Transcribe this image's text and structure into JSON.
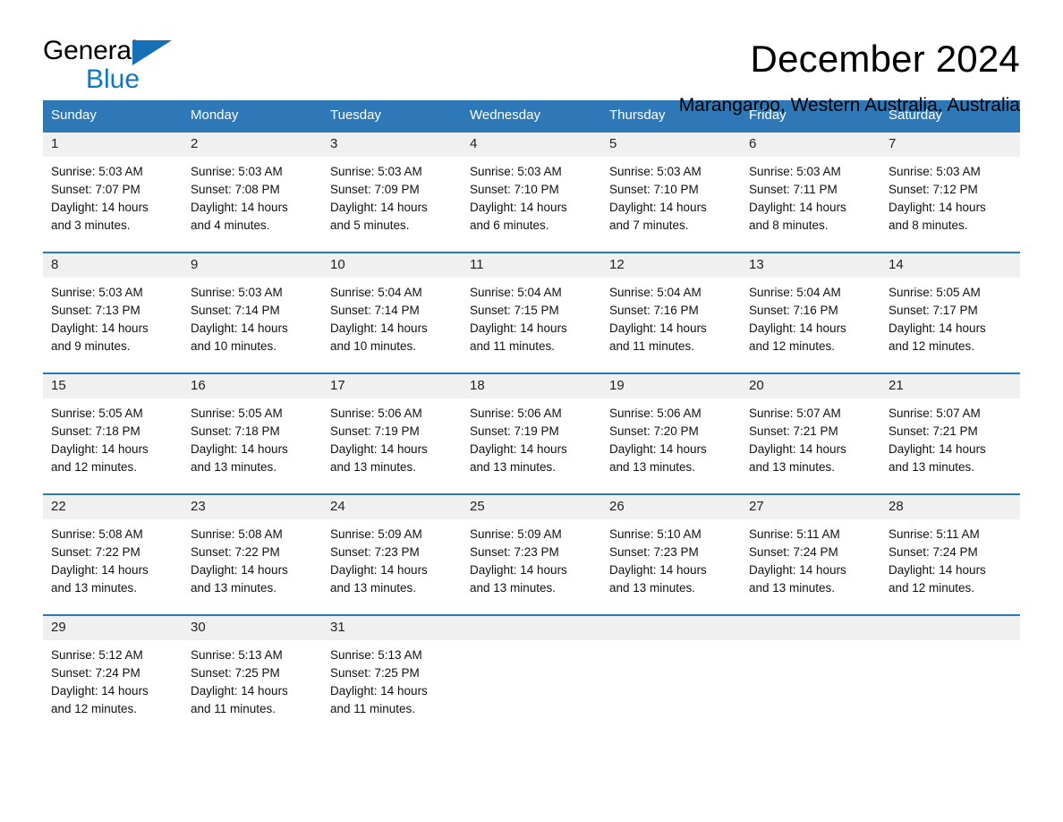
{
  "brand": {
    "name_part1": "General",
    "name_part2": "Blue",
    "triangle_color": "#1570b8",
    "blue_text_color": "#1277bc"
  },
  "header": {
    "title": "December 2024",
    "location": "Marangaroo, Western Australia, Australia"
  },
  "theme": {
    "header_blue": "#2f78b8",
    "daynum_band": "#f0f0f0",
    "row_divider": "#2f78b8"
  },
  "weekday_headers": [
    "Sunday",
    "Monday",
    "Tuesday",
    "Wednesday",
    "Thursday",
    "Friday",
    "Saturday"
  ],
  "labels": {
    "sunrise_prefix": "Sunrise:",
    "sunset_prefix": "Sunset:",
    "daylight_prefix": "Daylight:"
  },
  "weeks": [
    [
      {
        "day": "1",
        "sunrise": "Sunrise: 5:03 AM",
        "sunset": "Sunset: 7:07 PM",
        "daylight_l1": "Daylight: 14 hours",
        "daylight_l2": "and 3 minutes."
      },
      {
        "day": "2",
        "sunrise": "Sunrise: 5:03 AM",
        "sunset": "Sunset: 7:08 PM",
        "daylight_l1": "Daylight: 14 hours",
        "daylight_l2": "and 4 minutes."
      },
      {
        "day": "3",
        "sunrise": "Sunrise: 5:03 AM",
        "sunset": "Sunset: 7:09 PM",
        "daylight_l1": "Daylight: 14 hours",
        "daylight_l2": "and 5 minutes."
      },
      {
        "day": "4",
        "sunrise": "Sunrise: 5:03 AM",
        "sunset": "Sunset: 7:10 PM",
        "daylight_l1": "Daylight: 14 hours",
        "daylight_l2": "and 6 minutes."
      },
      {
        "day": "5",
        "sunrise": "Sunrise: 5:03 AM",
        "sunset": "Sunset: 7:10 PM",
        "daylight_l1": "Daylight: 14 hours",
        "daylight_l2": "and 7 minutes."
      },
      {
        "day": "6",
        "sunrise": "Sunrise: 5:03 AM",
        "sunset": "Sunset: 7:11 PM",
        "daylight_l1": "Daylight: 14 hours",
        "daylight_l2": "and 8 minutes."
      },
      {
        "day": "7",
        "sunrise": "Sunrise: 5:03 AM",
        "sunset": "Sunset: 7:12 PM",
        "daylight_l1": "Daylight: 14 hours",
        "daylight_l2": "and 8 minutes."
      }
    ],
    [
      {
        "day": "8",
        "sunrise": "Sunrise: 5:03 AM",
        "sunset": "Sunset: 7:13 PM",
        "daylight_l1": "Daylight: 14 hours",
        "daylight_l2": "and 9 minutes."
      },
      {
        "day": "9",
        "sunrise": "Sunrise: 5:03 AM",
        "sunset": "Sunset: 7:14 PM",
        "daylight_l1": "Daylight: 14 hours",
        "daylight_l2": "and 10 minutes."
      },
      {
        "day": "10",
        "sunrise": "Sunrise: 5:04 AM",
        "sunset": "Sunset: 7:14 PM",
        "daylight_l1": "Daylight: 14 hours",
        "daylight_l2": "and 10 minutes."
      },
      {
        "day": "11",
        "sunrise": "Sunrise: 5:04 AM",
        "sunset": "Sunset: 7:15 PM",
        "daylight_l1": "Daylight: 14 hours",
        "daylight_l2": "and 11 minutes."
      },
      {
        "day": "12",
        "sunrise": "Sunrise: 5:04 AM",
        "sunset": "Sunset: 7:16 PM",
        "daylight_l1": "Daylight: 14 hours",
        "daylight_l2": "and 11 minutes."
      },
      {
        "day": "13",
        "sunrise": "Sunrise: 5:04 AM",
        "sunset": "Sunset: 7:16 PM",
        "daylight_l1": "Daylight: 14 hours",
        "daylight_l2": "and 12 minutes."
      },
      {
        "day": "14",
        "sunrise": "Sunrise: 5:05 AM",
        "sunset": "Sunset: 7:17 PM",
        "daylight_l1": "Daylight: 14 hours",
        "daylight_l2": "and 12 minutes."
      }
    ],
    [
      {
        "day": "15",
        "sunrise": "Sunrise: 5:05 AM",
        "sunset": "Sunset: 7:18 PM",
        "daylight_l1": "Daylight: 14 hours",
        "daylight_l2": "and 12 minutes."
      },
      {
        "day": "16",
        "sunrise": "Sunrise: 5:05 AM",
        "sunset": "Sunset: 7:18 PM",
        "daylight_l1": "Daylight: 14 hours",
        "daylight_l2": "and 13 minutes."
      },
      {
        "day": "17",
        "sunrise": "Sunrise: 5:06 AM",
        "sunset": "Sunset: 7:19 PM",
        "daylight_l1": "Daylight: 14 hours",
        "daylight_l2": "and 13 minutes."
      },
      {
        "day": "18",
        "sunrise": "Sunrise: 5:06 AM",
        "sunset": "Sunset: 7:19 PM",
        "daylight_l1": "Daylight: 14 hours",
        "daylight_l2": "and 13 minutes."
      },
      {
        "day": "19",
        "sunrise": "Sunrise: 5:06 AM",
        "sunset": "Sunset: 7:20 PM",
        "daylight_l1": "Daylight: 14 hours",
        "daylight_l2": "and 13 minutes."
      },
      {
        "day": "20",
        "sunrise": "Sunrise: 5:07 AM",
        "sunset": "Sunset: 7:21 PM",
        "daylight_l1": "Daylight: 14 hours",
        "daylight_l2": "and 13 minutes."
      },
      {
        "day": "21",
        "sunrise": "Sunrise: 5:07 AM",
        "sunset": "Sunset: 7:21 PM",
        "daylight_l1": "Daylight: 14 hours",
        "daylight_l2": "and 13 minutes."
      }
    ],
    [
      {
        "day": "22",
        "sunrise": "Sunrise: 5:08 AM",
        "sunset": "Sunset: 7:22 PM",
        "daylight_l1": "Daylight: 14 hours",
        "daylight_l2": "and 13 minutes."
      },
      {
        "day": "23",
        "sunrise": "Sunrise: 5:08 AM",
        "sunset": "Sunset: 7:22 PM",
        "daylight_l1": "Daylight: 14 hours",
        "daylight_l2": "and 13 minutes."
      },
      {
        "day": "24",
        "sunrise": "Sunrise: 5:09 AM",
        "sunset": "Sunset: 7:23 PM",
        "daylight_l1": "Daylight: 14 hours",
        "daylight_l2": "and 13 minutes."
      },
      {
        "day": "25",
        "sunrise": "Sunrise: 5:09 AM",
        "sunset": "Sunset: 7:23 PM",
        "daylight_l1": "Daylight: 14 hours",
        "daylight_l2": "and 13 minutes."
      },
      {
        "day": "26",
        "sunrise": "Sunrise: 5:10 AM",
        "sunset": "Sunset: 7:23 PM",
        "daylight_l1": "Daylight: 14 hours",
        "daylight_l2": "and 13 minutes."
      },
      {
        "day": "27",
        "sunrise": "Sunrise: 5:11 AM",
        "sunset": "Sunset: 7:24 PM",
        "daylight_l1": "Daylight: 14 hours",
        "daylight_l2": "and 13 minutes."
      },
      {
        "day": "28",
        "sunrise": "Sunrise: 5:11 AM",
        "sunset": "Sunset: 7:24 PM",
        "daylight_l1": "Daylight: 14 hours",
        "daylight_l2": "and 12 minutes."
      }
    ],
    [
      {
        "day": "29",
        "sunrise": "Sunrise: 5:12 AM",
        "sunset": "Sunset: 7:24 PM",
        "daylight_l1": "Daylight: 14 hours",
        "daylight_l2": "and 12 minutes."
      },
      {
        "day": "30",
        "sunrise": "Sunrise: 5:13 AM",
        "sunset": "Sunset: 7:25 PM",
        "daylight_l1": "Daylight: 14 hours",
        "daylight_l2": "and 11 minutes."
      },
      {
        "day": "31",
        "sunrise": "Sunrise: 5:13 AM",
        "sunset": "Sunset: 7:25 PM",
        "daylight_l1": "Daylight: 14 hours",
        "daylight_l2": "and 11 minutes."
      },
      {
        "day": "",
        "sunrise": "",
        "sunset": "",
        "daylight_l1": "",
        "daylight_l2": "",
        "blank": true
      },
      {
        "day": "",
        "sunrise": "",
        "sunset": "",
        "daylight_l1": "",
        "daylight_l2": "",
        "blank": true
      },
      {
        "day": "",
        "sunrise": "",
        "sunset": "",
        "daylight_l1": "",
        "daylight_l2": "",
        "blank": true
      },
      {
        "day": "",
        "sunrise": "",
        "sunset": "",
        "daylight_l1": "",
        "daylight_l2": "",
        "blank": true
      }
    ]
  ]
}
